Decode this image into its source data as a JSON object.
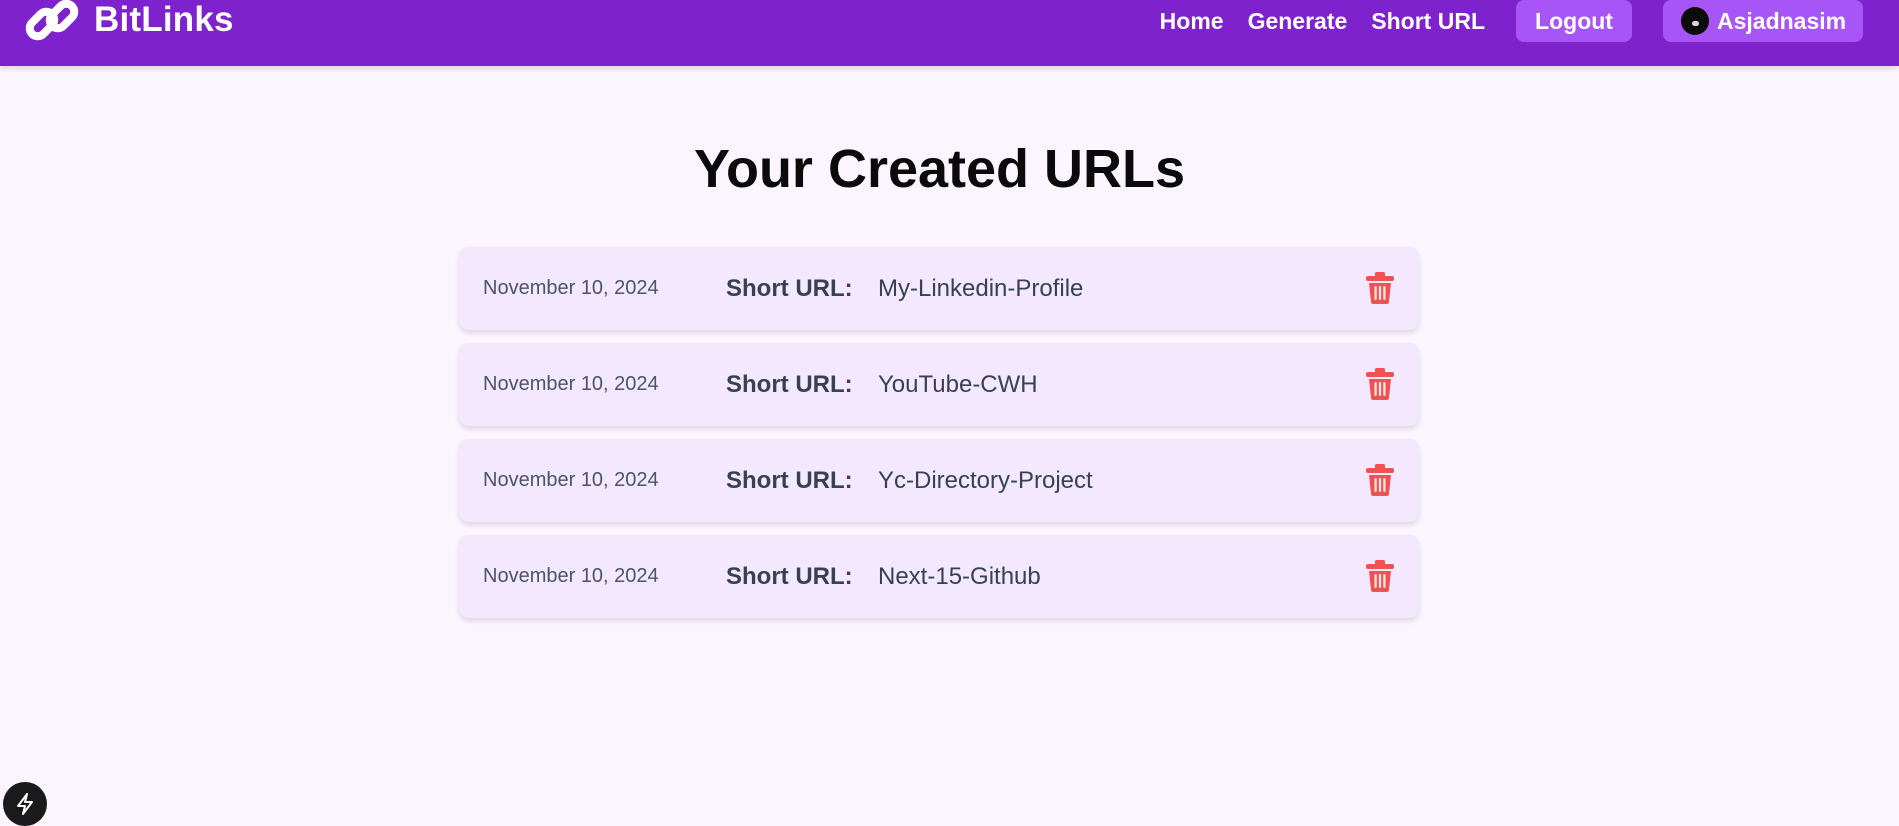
{
  "navbar": {
    "brand_name": "BitLinks",
    "brand_icon": "link-chain-icon",
    "links": [
      {
        "label": "Home"
      },
      {
        "label": "Generate"
      },
      {
        "label": "Short URL"
      }
    ],
    "logout_label": "Logout",
    "user_name": "Asjadnasim"
  },
  "page": {
    "title": "Your Created URLs"
  },
  "urls": [
    {
      "date": "November 10, 2024",
      "label": "Short URL:",
      "value": "My-Linkedin-Profile"
    },
    {
      "date": "November 10, 2024",
      "label": "Short URL:",
      "value": "YouTube-CWH"
    },
    {
      "date": "November 10, 2024",
      "label": "Short URL:",
      "value": "Yc-Directory-Project"
    },
    {
      "date": "November 10, 2024",
      "label": "Short URL:",
      "value": "Next-15-Github"
    }
  ],
  "colors": {
    "navbar_bg": "#7e22ce",
    "button_bg": "#a855f7",
    "card_bg": "#f3e8ff",
    "delete_red": "#f05252",
    "page_bg": "#faf5ff"
  },
  "icons": {
    "delete": "trash-icon",
    "dev_badge": "lightning-bolt-icon"
  }
}
